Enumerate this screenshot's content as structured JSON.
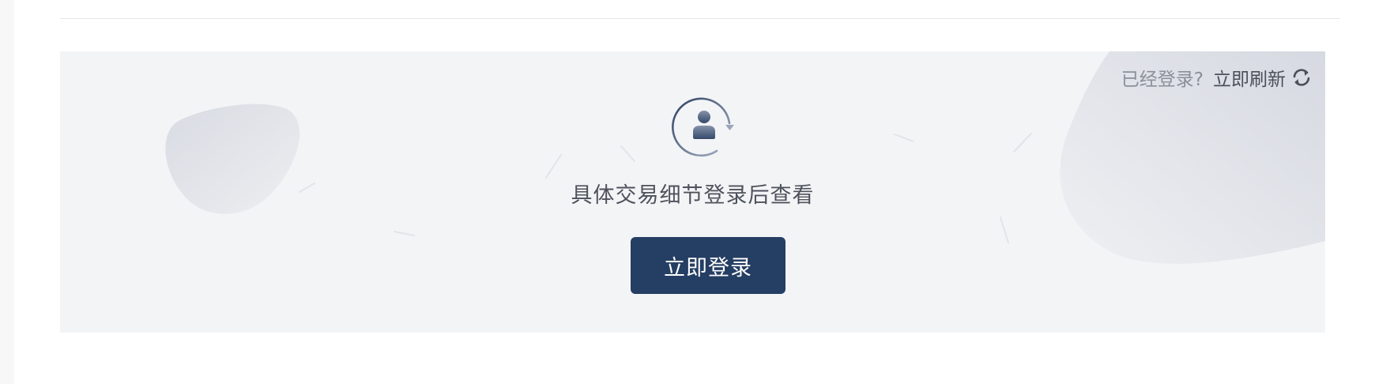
{
  "card": {
    "refresh_question": "已经登录?",
    "refresh_label": "立即刷新",
    "message": "具体交易细节登录后查看",
    "login_button_label": "立即登录"
  },
  "icons": {
    "center": "user-refresh-icon",
    "refresh": "refresh-icon"
  },
  "colors": {
    "button": "#253e63",
    "card_background": "#f3f4f6",
    "muted_text": "#8a8f99",
    "body_text": "#4d525c"
  }
}
